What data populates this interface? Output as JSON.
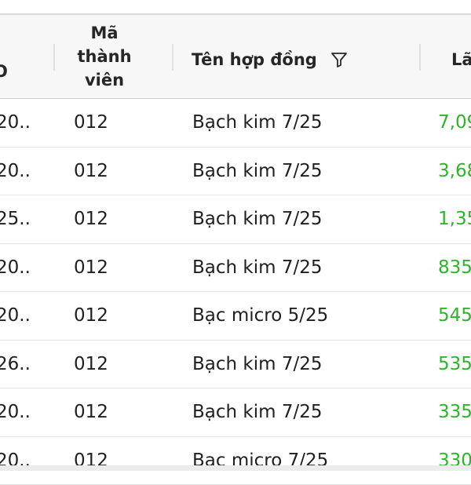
{
  "header": {
    "id_label": "O",
    "member_label_lines": [
      "Mã",
      "thành",
      "viên"
    ],
    "contract_label": "Tên hợp đồng",
    "profit_label": "Lã",
    "filter_icon": "filter-icon"
  },
  "rows": [
    {
      "id": "20...",
      "member": "012",
      "contract": "Bạch kim 7/25",
      "profit": "7,09"
    },
    {
      "id": "20...",
      "member": "012",
      "contract": "Bạch kim 7/25",
      "profit": "3,68"
    },
    {
      "id": "25...",
      "member": "012",
      "contract": "Bạch kim 7/25",
      "profit": "1,35"
    },
    {
      "id": "20...",
      "member": "012",
      "contract": "Bạch kim 7/25",
      "profit": "835"
    },
    {
      "id": "20...",
      "member": "012",
      "contract": "Bạc micro 5/25",
      "profit": "545"
    },
    {
      "id": "26...",
      "member": "012",
      "contract": "Bạch kim 7/25",
      "profit": "535"
    },
    {
      "id": "20...",
      "member": "012",
      "contract": "Bạch kim 7/25",
      "profit": "335"
    },
    {
      "id": "20...",
      "member": "012",
      "contract": "Bạc micro 7/25",
      "profit": "330"
    }
  ],
  "colors": {
    "profit_positive": "#2db52a",
    "header_bg": "#f7f7f8"
  }
}
